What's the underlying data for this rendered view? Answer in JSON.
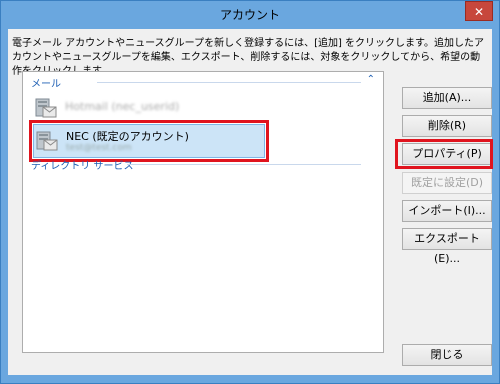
{
  "window": {
    "title": "アカウント",
    "close_glyph": "✕"
  },
  "description": "電子メール アカウントやニュースグループを新しく登録するには、[追加] をクリックします。追加したアカウントやニュースグループを編集、エクスポート、削除するには、対象をクリックしてから、希望の動作をクリックします。",
  "list": {
    "mail_group": {
      "label": "メール",
      "chevron": "⌃"
    },
    "accounts": [
      {
        "name": "Hotmail (nec_userid)",
        "email": "",
        "selected": false
      },
      {
        "name": "NEC (既定のアカウント)",
        "email": "test@test.com",
        "selected": true
      }
    ],
    "directory_group": {
      "label": "ディレクトリ サービス"
    }
  },
  "buttons": {
    "add": "追加(A)...",
    "delete": "削除(R)",
    "properties": "プロパティ(P)",
    "set_default": "既定に設定(D)",
    "import": "インポート(I)...",
    "export": "エクスポート(E)...",
    "close": "閉じる"
  },
  "colors": {
    "highlight_frame": "#e0141e",
    "selection": "#cce4f7",
    "group_text": "#1e5fb4"
  }
}
